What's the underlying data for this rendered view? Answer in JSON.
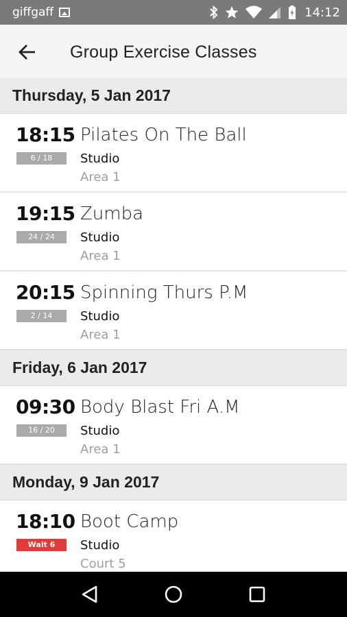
{
  "status_bar": {
    "carrier": "giffgaff",
    "time": "14:12",
    "icons": [
      "image-icon",
      "bluetooth-icon",
      "star-icon",
      "wifi-icon",
      "signal-icon",
      "battery-charging-icon"
    ]
  },
  "app_bar": {
    "title": "Group Exercise Classes",
    "back_icon": "back-arrow-icon"
  },
  "days": [
    {
      "date": "Thursday, 5 Jan 2017",
      "classes": [
        {
          "time": "18:15",
          "spaces": "6 / 18",
          "name": "Pilates On The Ball",
          "venue": "Studio",
          "area": "Area 1"
        },
        {
          "time": "19:15",
          "spaces": "24 / 24",
          "name": "Zumba",
          "venue": "Studio",
          "area": "Area 1"
        },
        {
          "time": "20:15",
          "spaces": "2 / 14",
          "name": "Spinning Thurs P.M",
          "venue": "Studio",
          "area": "Area 1"
        }
      ]
    },
    {
      "date": "Friday, 6 Jan 2017",
      "classes": [
        {
          "time": "09:30",
          "spaces": "16 / 20",
          "name": "Body Blast Fri A.M",
          "venue": "Studio",
          "area": "Area 1"
        }
      ]
    },
    {
      "date": "Monday, 9 Jan 2017",
      "classes": [
        {
          "time": "18:10",
          "spaces": "Wait 6",
          "name": "Boot Camp",
          "venue": "Studio",
          "area": "Court 5",
          "waitlist": true
        }
      ]
    }
  ],
  "colors": {
    "status_bar": "#7a7a7a",
    "app_bar": "#f5f5f5",
    "day_header": "#ebebeb",
    "badge": "#aaaaaa",
    "waitlist_badge": "#e53935",
    "nav_bar": "#000000"
  },
  "nav_bar": {
    "buttons": [
      "back-triangle-icon",
      "home-circle-icon",
      "recents-square-icon"
    ]
  }
}
